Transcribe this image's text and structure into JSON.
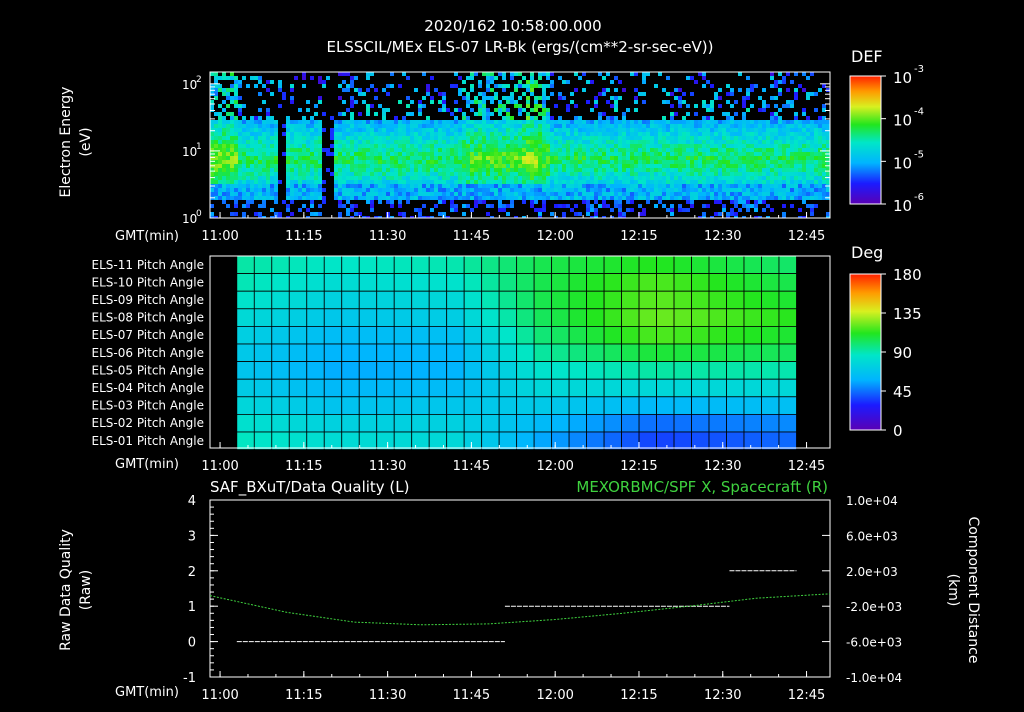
{
  "header": {
    "time": "2020/162 10:58:00.000",
    "subtitle": "ELSSCIL/MEx ELS-07 LR-Bk  (ergs/(cm**2-sr-sec-eV))"
  },
  "colors": {
    "background": "#000000",
    "axis": "#ffffff",
    "spacecraft_series": "#3fd23f",
    "quality_series": "#ffffff"
  },
  "chart_data": [
    {
      "type": "heatmap",
      "name": "electron-spectrogram",
      "ylabel": [
        "Electron Energy",
        "(eV)"
      ],
      "y_scale": "log",
      "ylim": [
        1,
        150
      ],
      "yticks": [
        {
          "value": 100,
          "mantissa": "10",
          "exp": "2"
        },
        {
          "value": 10,
          "mantissa": "10",
          "exp": "1"
        },
        {
          "value": 1,
          "mantissa": "10",
          "exp": "0"
        }
      ],
      "x_axis_label": "GMT(min)",
      "xlim_minutes": [
        10.97,
        12.82
      ],
      "xticks": [
        {
          "label": "11:00",
          "value": 11.0
        },
        {
          "label": "11:15",
          "value": 11.25
        },
        {
          "label": "11:30",
          "value": 11.5
        },
        {
          "label": "11:45",
          "value": 11.75
        },
        {
          "label": "12:00",
          "value": 12.0
        },
        {
          "label": "12:15",
          "value": 12.25
        },
        {
          "label": "12:30",
          "value": 12.5
        },
        {
          "label": "12:45",
          "value": 12.75
        }
      ],
      "colorbar": {
        "title": "DEF",
        "scale": "log",
        "range": [
          1e-06,
          0.001
        ],
        "ticks": [
          {
            "mantissa": "10",
            "exp": "-3",
            "value": 0.001
          },
          {
            "mantissa": "10",
            "exp": "-4",
            "value": 0.0001
          },
          {
            "mantissa": "10",
            "exp": "-5",
            "value": 1e-05
          },
          {
            "mantissa": "10",
            "exp": "-6",
            "value": 1e-06
          }
        ]
      },
      "features": {
        "core_band_ev": [
          3,
          30
        ],
        "peak_level_log": -4.0
      }
    },
    {
      "type": "heatmap",
      "name": "pitch-angle",
      "rows": [
        "ELS-11 Pitch Angle",
        "ELS-10 Pitch Angle",
        "ELS-09 Pitch Angle",
        "ELS-08 Pitch Angle",
        "ELS-07 Pitch Angle",
        "ELS-06 Pitch Angle",
        "ELS-05 Pitch Angle",
        "ELS-04 Pitch Angle",
        "ELS-03 Pitch Angle",
        "ELS-02 Pitch Angle",
        "ELS-01 Pitch Angle"
      ],
      "x_axis_label": "GMT(min)",
      "xticks": [
        "11:00",
        "11:15",
        "11:30",
        "11:45",
        "12:00",
        "12:15",
        "12:30",
        "12:45"
      ],
      "columns": 32,
      "data_start": 11.05,
      "data_end": 12.72,
      "colorbar": {
        "title": "Deg",
        "range": [
          0,
          180
        ],
        "ticks": [
          "180",
          "135",
          "90",
          "45",
          "0"
        ]
      },
      "keyframes": [
        {
          "t": 11.05,
          "values": [
            92,
            90,
            86,
            80,
            74,
            70,
            68,
            72,
            78,
            84,
            88
          ]
        },
        {
          "t": 11.35,
          "values": [
            86,
            80,
            74,
            68,
            62,
            58,
            56,
            60,
            66,
            74,
            80
          ]
        },
        {
          "t": 11.7,
          "values": [
            90,
            84,
            78,
            72,
            64,
            60,
            58,
            62,
            68,
            74,
            78
          ]
        },
        {
          "t": 11.95,
          "values": [
            104,
            104,
            104,
            102,
            98,
            92,
            84,
            78,
            70,
            62,
            56
          ]
        },
        {
          "t": 12.3,
          "values": [
            112,
            118,
            120,
            122,
            118,
            108,
            92,
            78,
            60,
            44,
            36
          ]
        },
        {
          "t": 12.72,
          "values": [
            100,
            104,
            108,
            112,
            108,
            102,
            90,
            78,
            64,
            50,
            44
          ]
        }
      ]
    },
    {
      "type": "line",
      "name": "data-quality",
      "title_left": "SAF_BXuT/Data Quality (L)",
      "title_right": "MEXORBMC/SPF X, Spacecraft (R)",
      "ylabel_left": [
        "Raw Data Quality",
        "(Raw)"
      ],
      "ylabel_right": [
        "Component Distance",
        "(km)"
      ],
      "ylim_left": [
        -1,
        4
      ],
      "yticks_left": [
        "4",
        "3",
        "2",
        "1",
        "0",
        "-1"
      ],
      "ylim_right": [
        -10000,
        10000
      ],
      "yticks_right": [
        "1.0e+04",
        "6.0e+03",
        "2.0e+03",
        "-2.0e+03",
        "-6.0e+03",
        "-1.0e+04"
      ],
      "x_axis_label": "GMT(min)",
      "xticks": [
        "11:00",
        "11:15",
        "11:30",
        "11:45",
        "12:00",
        "12:15",
        "12:30",
        "12:45"
      ],
      "series": [
        {
          "axis": "left",
          "style": "dashed",
          "segments": [
            {
              "x": [
                11.05,
                11.85
              ],
              "y": 0
            },
            {
              "x": [
                11.85,
                12.52
              ],
              "y": 1
            },
            {
              "x": [
                12.52,
                12.72
              ],
              "y": 2
            }
          ]
        },
        {
          "axis": "right",
          "style": "dotted",
          "x": [
            10.97,
            11.2,
            11.4,
            11.6,
            11.8,
            12.0,
            12.2,
            12.4,
            12.6,
            12.82
          ],
          "y": [
            -800,
            -2700,
            -3800,
            -4100,
            -4000,
            -3500,
            -2800,
            -2000,
            -1100,
            -600
          ]
        }
      ]
    }
  ]
}
